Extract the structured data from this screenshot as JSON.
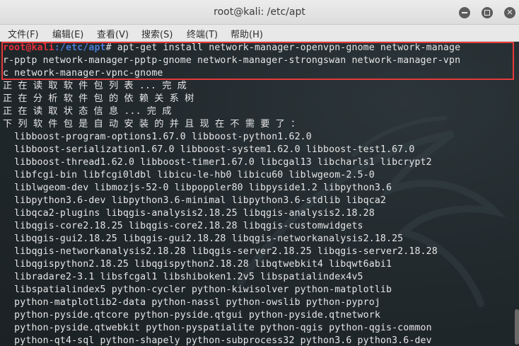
{
  "window": {
    "title": "root@kali: /etc/apt"
  },
  "menu": {
    "items": [
      "文件(F)",
      "编辑(E)",
      "查看(V)",
      "搜索(S)",
      "终端(T)",
      "帮助(H)"
    ]
  },
  "prompt": {
    "user_host": "root@kali",
    "path": ":/etc/apt",
    "symbol": "#"
  },
  "command": {
    "line1": " apt-get install network-manager-openvpn-gnome network-manage",
    "line2": "r-pptp network-manager-pptp-gnome network-manager-strongswan network-manager-vpn",
    "line3": "c network-manager-vpnc-gnome"
  },
  "output": [
    "正 在 读 取 软 件 包 列 表 ... 完 成",
    "正 在 分 析 软 件 包 的 依 赖 关 系 树",
    "正 在 读 取 状 态 信 息 ... 完 成",
    "下 列 软 件 包 是 自 动 安 装 的 并 且 现 在 不 需 要 了 ：",
    "  libboost-program-options1.67.0 libboost-python1.62.0",
    "  libboost-serialization1.67.0 libboost-system1.62.0 libboost-test1.67.0",
    "  libboost-thread1.62.0 libboost-timer1.67.0 libcgal13 libcharls1 libcrypt2",
    "  libfcgi-bin libfcgi0ldbl libicu-le-hb0 libicu60 liblwgeom-2.5-0",
    "  liblwgeom-dev libmozjs-52-0 libpoppler80 libpyside1.2 libpython3.6",
    "  libpython3.6-dev libpython3.6-minimal libpython3.6-stdlib libqca2",
    "  libqca2-plugins libqgis-analysis2.18.25 libqgis-analysis2.18.28",
    "  libqgis-core2.18.25 libqgis-core2.18.28 libqgis-customwidgets",
    "  libqgis-gui2.18.25 libqgis-gui2.18.28 libqgis-networkanalysis2.18.25",
    "  libqgis-networkanalysis2.18.28 libqgis-server2.18.25 libqgis-server2.18.28",
    "  libqgispython2.18.25 libqgispython2.18.28 libqtwebkit4 libqwt6abi1",
    "  libradare2-3.1 libsfcgal1 libshiboken1.2v5 libspatialindex4v5",
    "  libspatialindex5 python-cycler python-kiwisolver python-matplotlib",
    "  python-matplotlib2-data python-nassl python-owslib python-pyproj",
    "  python-pyside.qtcore python-pyside.qtgui python-pyside.qtnetwork",
    "  python-pyside.qtwebkit python-pyspatialite python-qgis python-qgis-common",
    "  python-qt4-sql python-shapely python-subprocess32 python3.6 python3.6-dev"
  ]
}
